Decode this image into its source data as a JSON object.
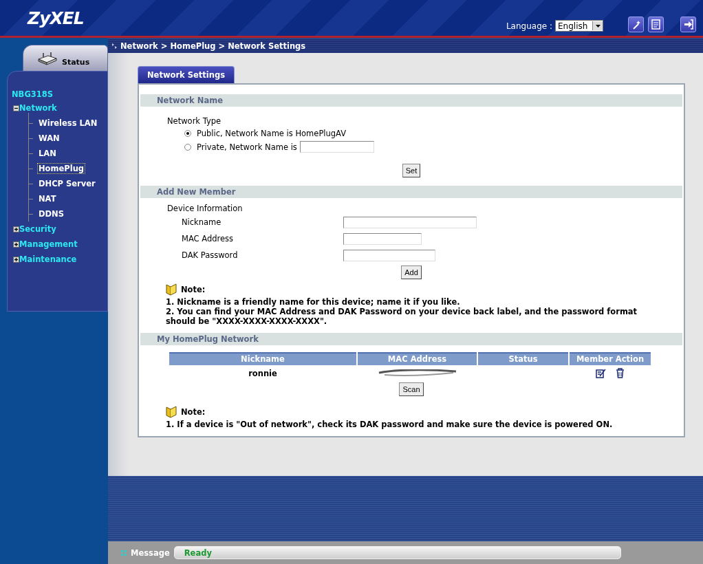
{
  "header": {
    "logo": "ZyXEL",
    "language_label": "Language :",
    "language_value": "English"
  },
  "sidebar": {
    "status_tab": "Status",
    "device": "NBG318S",
    "tree": [
      {
        "label": "Network",
        "expanded": true,
        "children": [
          {
            "label": "Wireless LAN",
            "selected": false
          },
          {
            "label": "WAN",
            "selected": false
          },
          {
            "label": "LAN",
            "selected": false
          },
          {
            "label": "HomePlug",
            "selected": true
          },
          {
            "label": "DHCP Server",
            "selected": false
          },
          {
            "label": "NAT",
            "selected": false
          },
          {
            "label": "DDNS",
            "selected": false
          }
        ]
      },
      {
        "label": "Security",
        "expanded": false
      },
      {
        "label": "Management",
        "expanded": false
      },
      {
        "label": "Maintenance",
        "expanded": false
      }
    ]
  },
  "breadcrumb": "Network > HomePlug > Network Settings",
  "tabs": [
    {
      "label": "Network Settings",
      "selected": true
    }
  ],
  "network_name": {
    "title": "Network Name",
    "group_label": "Network Type",
    "options": [
      {
        "label": "Public, Network Name is HomePlugAV",
        "selected": true,
        "kind": "plain"
      },
      {
        "label": "Private, Network Name is",
        "selected": false,
        "kind": "with-field"
      }
    ],
    "button": "Set"
  },
  "add_member": {
    "title": "Add New Member",
    "group_label": "Device Information",
    "fields": [
      {
        "label": "Nickname"
      },
      {
        "label": "MAC Address"
      },
      {
        "label": "DAK Password"
      }
    ],
    "button": "Add",
    "note": {
      "title": "Note:",
      "lines": [
        "1. Nickname is a friendly name for this device; name it if you like.",
        "2. You can find your MAC Address and DAK Password on your device back label, and the password format should be \"XXXX-XXXX-XXXX-XXXX\"."
      ]
    }
  },
  "my_network": {
    "title": "My HomePlug Network",
    "table": {
      "columns": [
        "Nickname",
        "MAC Address",
        "Status",
        "Member Action"
      ],
      "rows": [
        {
          "nickname": "ronnie"
        }
      ]
    },
    "button": "Scan",
    "note": {
      "title": "Note:",
      "lines": [
        "1. If a device is \"Out of network\", check its DAK password and make sure the device is powered ON."
      ]
    }
  },
  "status_bar": {
    "label": "Message",
    "value": "Ready"
  }
}
